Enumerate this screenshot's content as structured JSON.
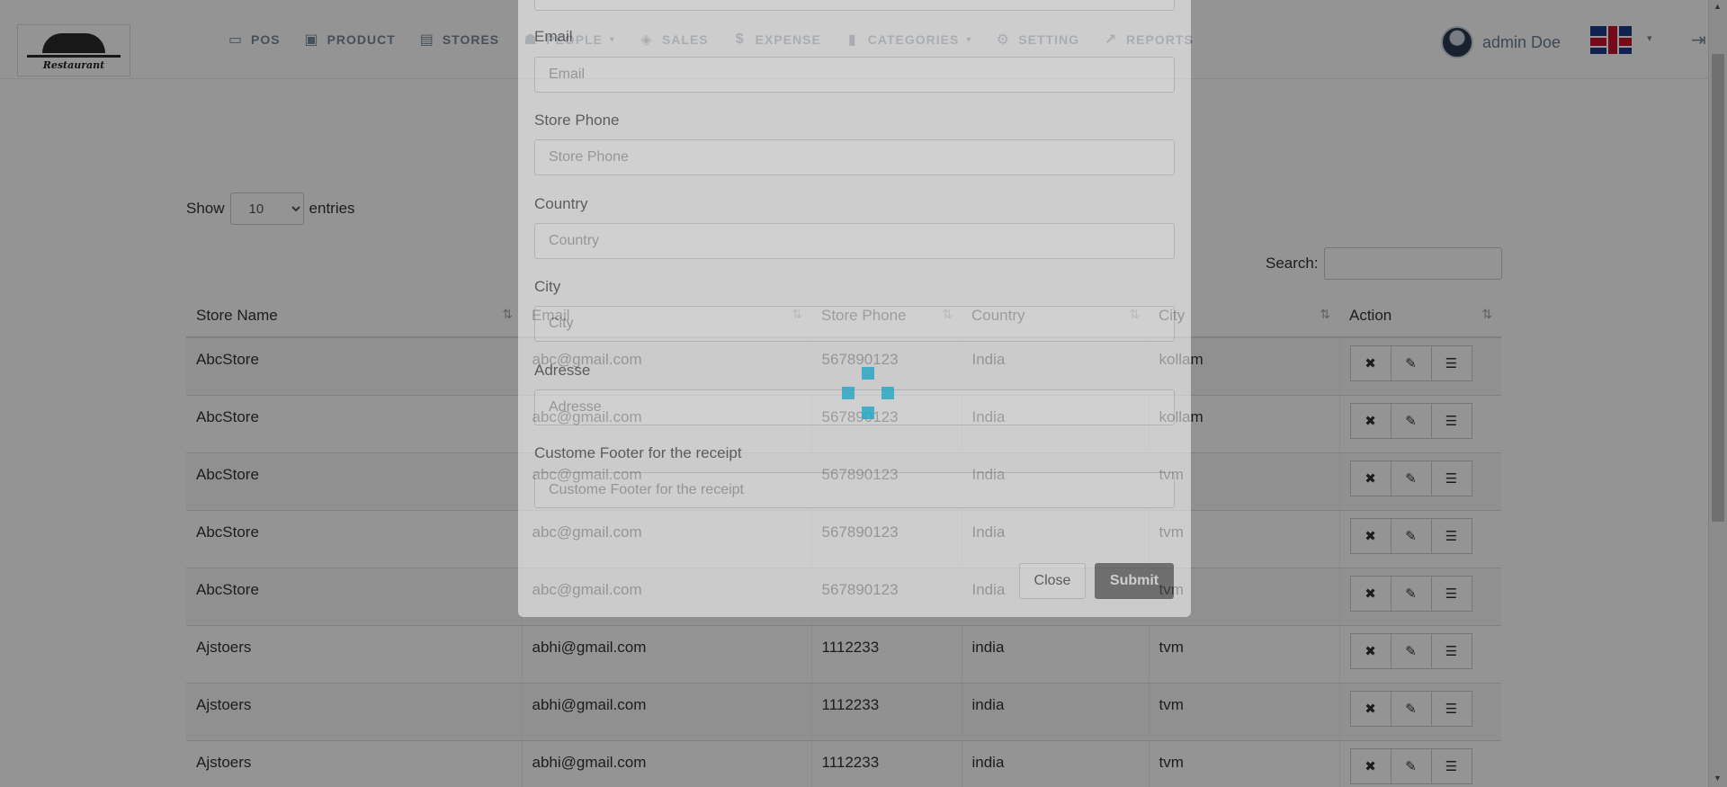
{
  "header": {
    "logo_text": "Restaurant",
    "nav": [
      {
        "label": "POS",
        "icon": "credit-card-icon",
        "glyph": "▭",
        "has_caret": false
      },
      {
        "label": "PRODUCT",
        "icon": "archive-icon",
        "glyph": "▣",
        "has_caret": false
      },
      {
        "label": "STORES",
        "icon": "clipboard-icon",
        "glyph": "▤",
        "has_caret": false
      },
      {
        "label": "PEOPLE",
        "icon": "users-icon",
        "glyph": "☗",
        "has_caret": true
      },
      {
        "label": "SALES",
        "icon": "tag-icon",
        "glyph": "◈",
        "has_caret": false
      },
      {
        "label": "EXPENSE",
        "icon": "dollar-icon",
        "glyph": "$",
        "has_caret": false
      },
      {
        "label": "CATEGORIES",
        "icon": "bookmark-icon",
        "glyph": "▮",
        "has_caret": true
      },
      {
        "label": "SETTING",
        "icon": "cogs-icon",
        "glyph": "⚙",
        "has_caret": false
      },
      {
        "label": "REPORTS",
        "icon": "line-chart-icon",
        "glyph": "↗",
        "has_caret": false
      }
    ],
    "user_name": "admin Doe",
    "caret_glyph": "▾",
    "logout_glyph": "⇥"
  },
  "table_controls": {
    "show_label": "Show",
    "entries_value": "10",
    "entries_label": "entries",
    "search_label": "Search:"
  },
  "table": {
    "columns": [
      "Store Name",
      "Email",
      "Store Phone",
      "Country",
      "City",
      "Action"
    ],
    "sort_glyph": "⇅",
    "rows": [
      [
        "AbcStore",
        "abc@gmail.com",
        "567890123",
        "India",
        "kollam"
      ],
      [
        "AbcStore",
        "abc@gmail.com",
        "567890123",
        "India",
        "kollam"
      ],
      [
        "AbcStore",
        "abc@gmail.com",
        "567890123",
        "India",
        "tvm"
      ],
      [
        "AbcStore",
        "abc@gmail.com",
        "567890123",
        "India",
        "tvm"
      ],
      [
        "AbcStore",
        "abc@gmail.com",
        "567890123",
        "India",
        "tvm"
      ],
      [
        "Ajstoers",
        "abhi@gmail.com",
        "1112233",
        "india",
        "tvm"
      ],
      [
        "Ajstoers",
        "abhi@gmail.com",
        "1112233",
        "india",
        "tvm"
      ],
      [
        "Ajstoers",
        "abhi@gmail.com",
        "1112233",
        "india",
        "tvm"
      ]
    ],
    "action_glyphs": {
      "delete": "✖",
      "edit": "✎",
      "details": "☰"
    }
  },
  "modal": {
    "email_label": "Email",
    "email_placeholder": "Email",
    "phone_label": "Store Phone",
    "phone_placeholder": "Store Phone",
    "country_label": "Country",
    "country_placeholder": "Country",
    "city_label": "City",
    "city_placeholder": "City",
    "address_label": "Adresse",
    "address_placeholder": "Adresse",
    "footer_label": "Custome Footer for the receipt",
    "footer_placeholder": "Custome Footer for the receipt",
    "close_label": "Close",
    "submit_label": "Submit"
  },
  "colors": {
    "spinner": "#29a9c6",
    "overlay": "rgba(0,0,0,0.42)",
    "nav_text": "#7a8a9a"
  }
}
